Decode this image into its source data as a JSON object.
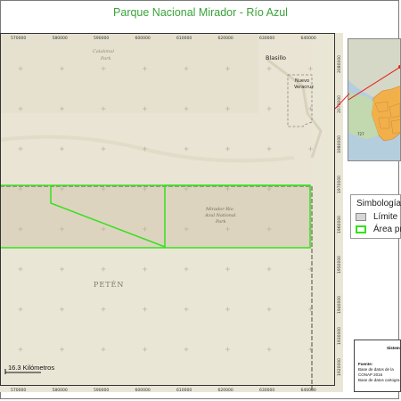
{
  "title": "Parque Nacional Mirador - Río Azul",
  "map": {
    "x_ticks": [
      "570000",
      "580000",
      "590000",
      "600000",
      "610000",
      "620000",
      "630000",
      "640000"
    ],
    "y_ticks": [
      "2080000",
      "2070000",
      "1980000",
      "1970000",
      "1960000",
      "1950000",
      "1940000",
      "1930000",
      "1920000"
    ],
    "labels": {
      "calakmul_1": "Calakmul",
      "calakmul_2": "Park",
      "blasillo": "Blasillo",
      "nuevo_1": "Nuevo",
      "nuevo_2": "Veracruz",
      "mirador_1": "Mirador-Rio",
      "mirador_2": "Azul National",
      "mirador_3": "Park",
      "peten": "PETÉN"
    },
    "scale_label": "16.3 Kilómetros",
    "colors": {
      "terrain": "#eae6d6",
      "protected_area": "#dcd3bf",
      "boundary_green": "#37e01f",
      "border_dash": "#8a8478"
    }
  },
  "inset": {
    "label": "727"
  },
  "legend": {
    "title": "Simbología",
    "items": [
      {
        "label": "Límite",
        "color": "#d6d6d6",
        "border": "#888888"
      },
      {
        "label": "Área pr",
        "color": "#ffffff",
        "border": "#37e01f"
      }
    ]
  },
  "info": {
    "system": "Sistem",
    "fuente": "Fuente:",
    "line1": "Base de datos de la",
    "line2": "CONAP 2016",
    "line3": "Base de datos cartogra"
  }
}
